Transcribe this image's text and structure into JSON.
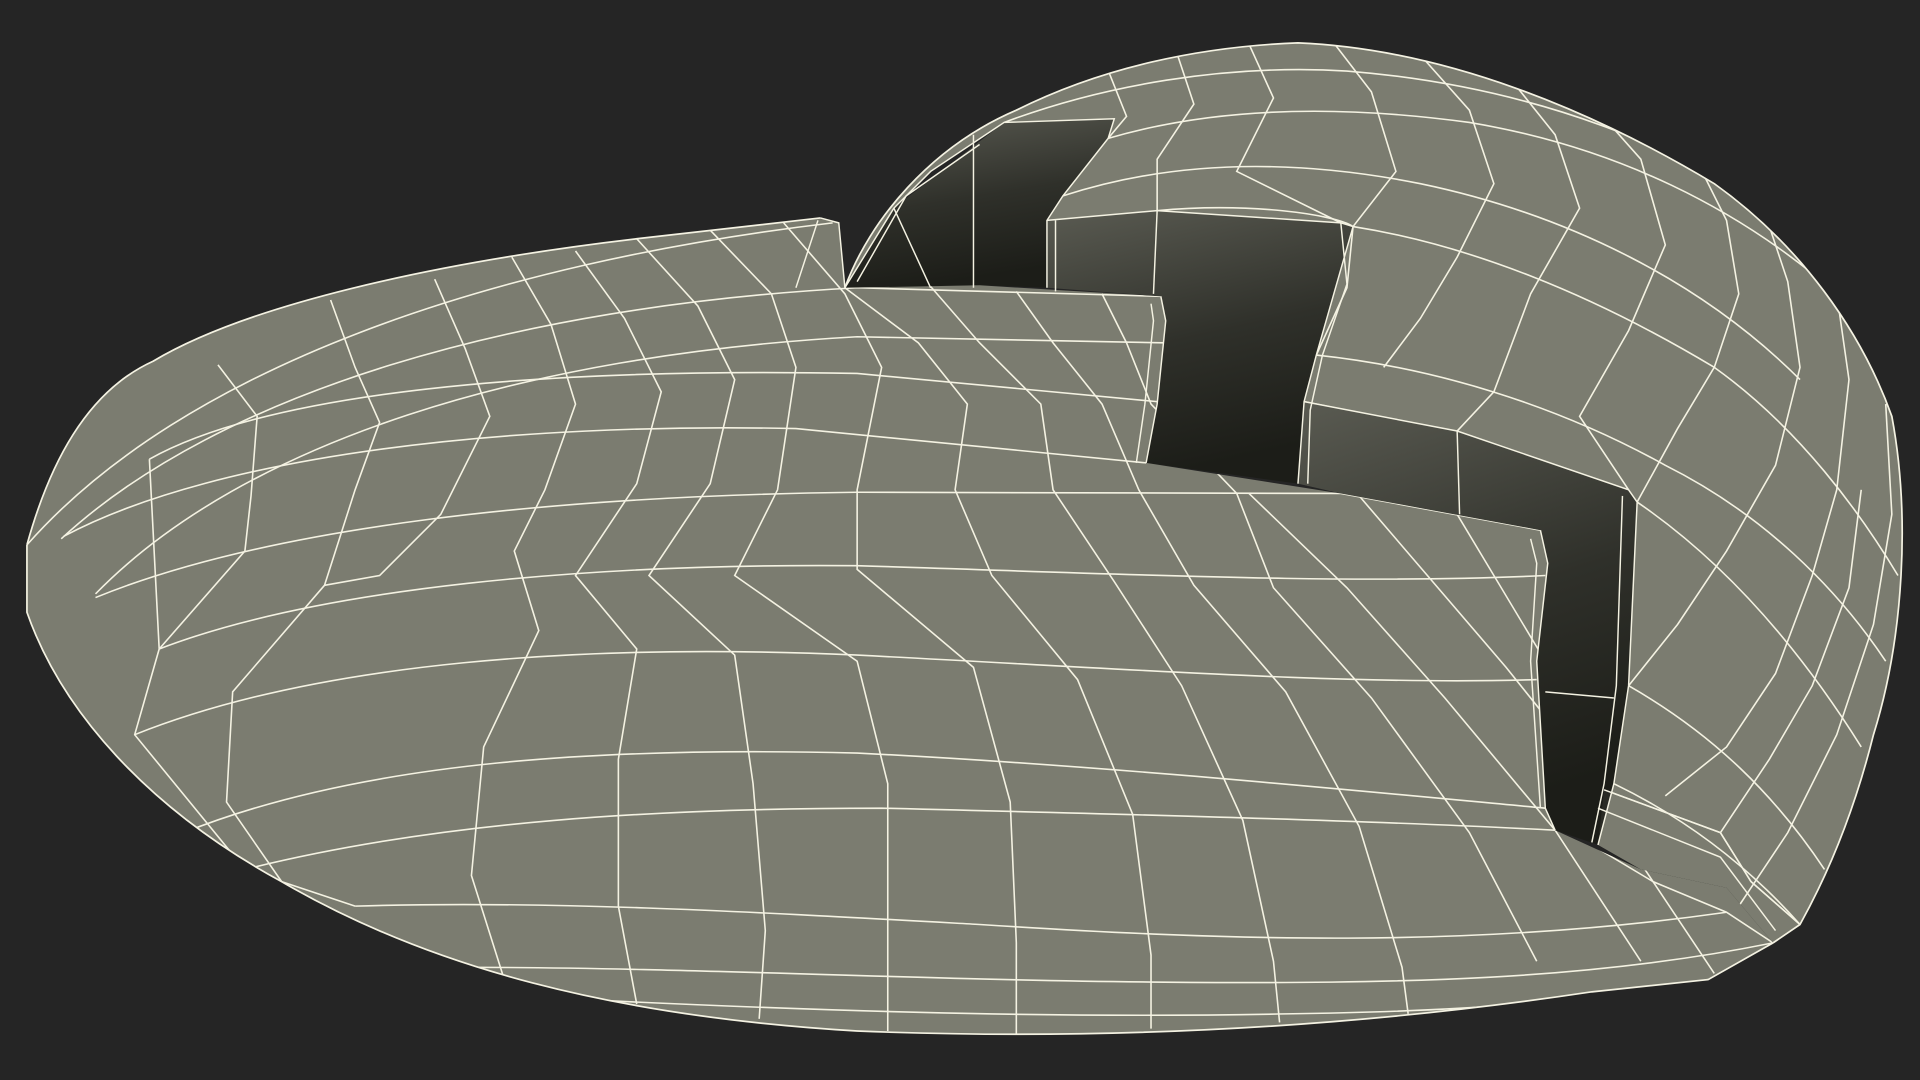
{
  "scene": {
    "subject": "broken-heart-wireframe",
    "render_mode": "wireframe-over-shaded"
  },
  "colors": {
    "background": "#252525",
    "surface": "#7b7c70",
    "wire": "#f4f2e2",
    "crack_light": "#55564e",
    "crack_dark": "#1f201b"
  }
}
